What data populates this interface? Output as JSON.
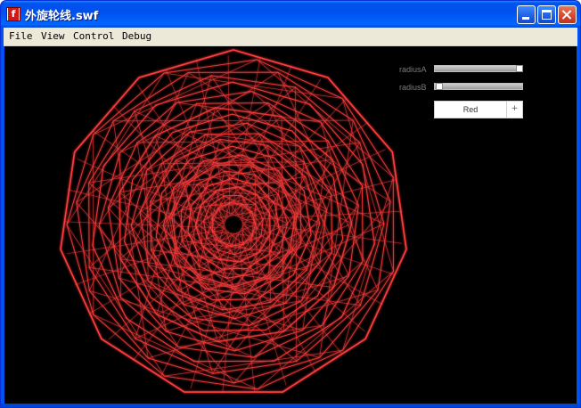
{
  "window": {
    "title": "外旋轮线.swf",
    "icon": "flash-player-icon"
  },
  "title_buttons": {
    "minimize": "minimize-icon",
    "maximize": "maximize-icon",
    "close": "close-icon"
  },
  "menubar": {
    "items": [
      "File",
      "View",
      "Control",
      "Debug"
    ]
  },
  "controls": {
    "radiusA_label": "radiusA",
    "radiusA_value": 1.0,
    "radiusB_label": "radiusB",
    "radiusB_value": 0.0,
    "color_select_value": "Red",
    "color_select_button": "+"
  },
  "colors": {
    "stage_background": "#000000",
    "curve_stroke": "#ff3c3c",
    "curve_glow": "#ff0000"
  }
}
